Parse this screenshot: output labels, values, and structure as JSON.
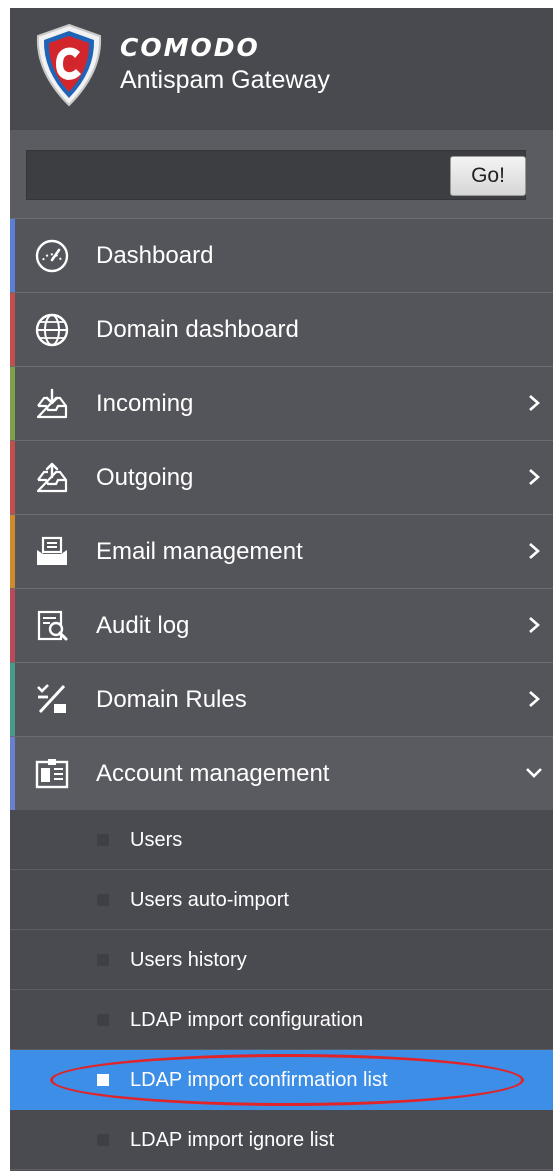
{
  "app": {
    "brand_name": "COMODO",
    "product_name": "Antispam Gateway",
    "logo_icon": "comodo-shield-logo",
    "colors": {
      "header_bg": "#484a4f",
      "menu_bg": "#54555a",
      "submenu_bg": "#4a4b50",
      "selected_bg": "#3c8ee6",
      "highlight_ring": "#e0242a"
    }
  },
  "search": {
    "value": "",
    "placeholder": "",
    "go_label": "Go!"
  },
  "menu": {
    "items": [
      {
        "label": "Dashboard",
        "icon": "gauge-icon",
        "accent": "#5b7fd6",
        "has_submenu": false
      },
      {
        "label": "Domain dashboard",
        "icon": "globe-icon",
        "accent": "#c0504d",
        "has_submenu": false
      },
      {
        "label": "Incoming",
        "icon": "inbox-download-icon",
        "accent": "#7da04a",
        "has_submenu": true
      },
      {
        "label": "Outgoing",
        "icon": "outbox-upload-icon",
        "accent": "#c0504d",
        "has_submenu": true
      },
      {
        "label": "Email management",
        "icon": "envelope-tray-icon",
        "accent": "#d08a2e",
        "has_submenu": true
      },
      {
        "label": "Audit log",
        "icon": "document-search-icon",
        "accent": "#b94a5a",
        "has_submenu": true
      },
      {
        "label": "Domain Rules",
        "icon": "percent-rules-icon",
        "accent": "#4a9a8a",
        "has_submenu": true
      },
      {
        "label": "Account management",
        "icon": "id-card-icon",
        "accent": "#6a7fd0",
        "has_submenu": true,
        "expanded": true
      }
    ]
  },
  "submenu": {
    "items": [
      {
        "label": "Users",
        "selected": false
      },
      {
        "label": "Users auto-import",
        "selected": false
      },
      {
        "label": "Users history",
        "selected": false
      },
      {
        "label": "LDAP import configuration",
        "selected": false
      },
      {
        "label": "LDAP import confirmation list",
        "selected": true
      },
      {
        "label": "LDAP import ignore list",
        "selected": false
      }
    ]
  }
}
